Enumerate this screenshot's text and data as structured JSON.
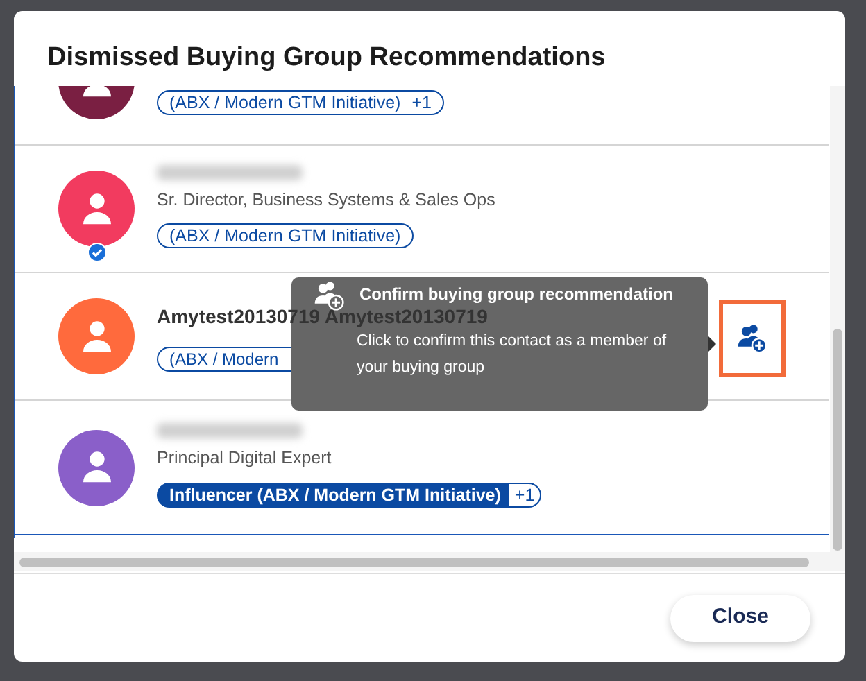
{
  "dialog": {
    "title": "Dismissed Buying Group Recommendations"
  },
  "contacts": [
    {
      "redacted": false,
      "color": "#7a1f42",
      "verified": false,
      "tags": [
        {
          "label": "(ABX / Modern GTM Initiative)",
          "filled": false,
          "extra": "+1"
        }
      ]
    },
    {
      "redacted": true,
      "title": "Sr. Director, Business Systems & Sales Ops",
      "color": "#f23b5f",
      "verified": true,
      "tags": [
        {
          "label": "(ABX / Modern GTM Initiative)",
          "filled": false
        }
      ]
    },
    {
      "redacted": false,
      "name": "Amytest20130719 Amytest20130719",
      "color": "#ff6a3d",
      "verified": false,
      "tags": [
        {
          "label": "(ABX / Modern",
          "filled": false
        }
      ],
      "action": {
        "focused": true
      }
    },
    {
      "redacted": true,
      "title": "Principal Digital Expert",
      "color": "#8a5fc9",
      "verified": false,
      "tags": [
        {
          "label": "Influencer (ABX / Modern GTM Initiative)",
          "filled": true,
          "extra": "+1"
        }
      ]
    }
  ],
  "tooltip": {
    "title": "Confirm buying group recommendation",
    "text": "Click to confirm this contact as a member of your buying group"
  },
  "buttons": [
    {
      "label": "Close"
    }
  ]
}
